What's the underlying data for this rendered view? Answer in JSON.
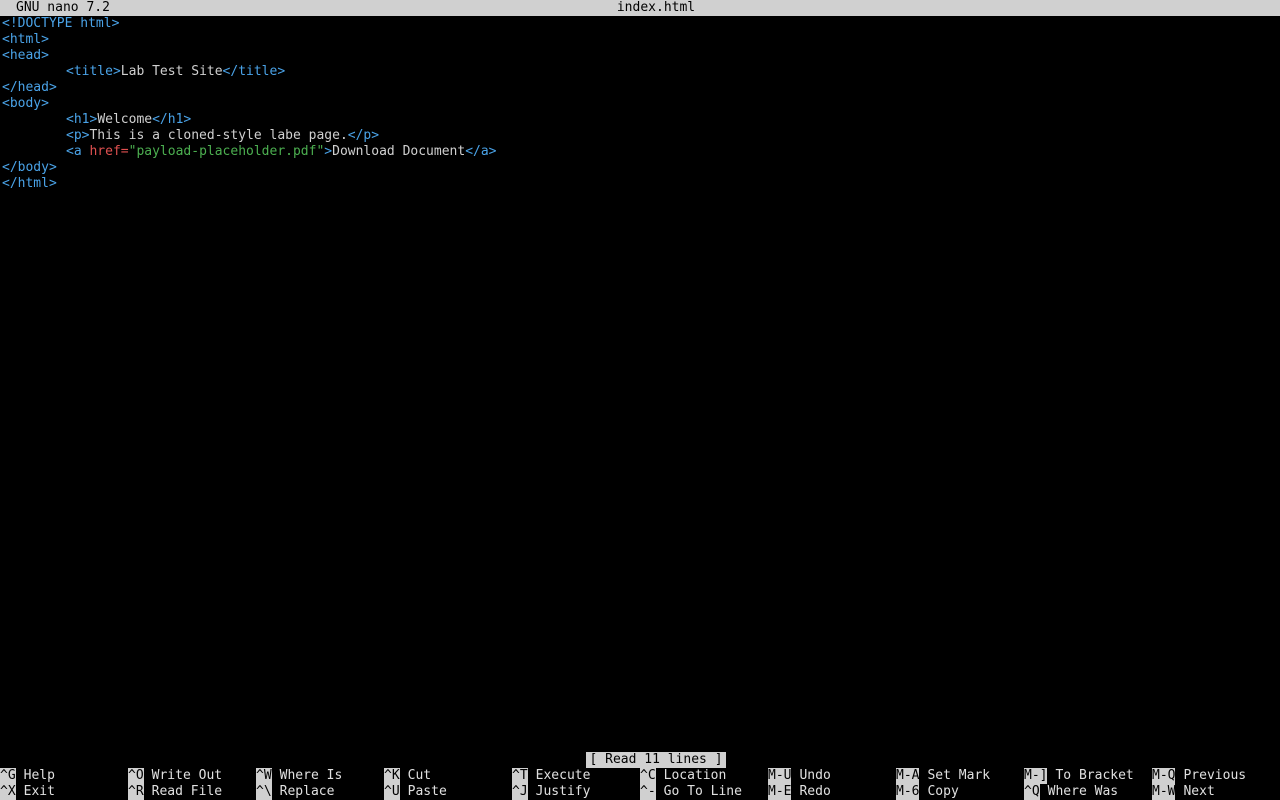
{
  "titlebar": {
    "version": "GNU nano 7.2",
    "filename": "index.html"
  },
  "code": [
    {
      "indent": 0,
      "parts": [
        {
          "cls": "tag",
          "text": "<!DOCTYPE html>"
        }
      ]
    },
    {
      "indent": 0,
      "parts": [
        {
          "cls": "tag",
          "text": "<html>"
        }
      ]
    },
    {
      "indent": 0,
      "parts": [
        {
          "cls": "tag",
          "text": "<head>"
        }
      ]
    },
    {
      "indent": 1,
      "parts": [
        {
          "cls": "tag",
          "text": "<title>"
        },
        {
          "cls": "txt",
          "text": "Lab Test Site"
        },
        {
          "cls": "tag",
          "text": "</title>"
        }
      ]
    },
    {
      "indent": 0,
      "parts": [
        {
          "cls": "tag",
          "text": "</head>"
        }
      ]
    },
    {
      "indent": 0,
      "parts": [
        {
          "cls": "tag",
          "text": "<body>"
        }
      ]
    },
    {
      "indent": 1,
      "parts": [
        {
          "cls": "tag",
          "text": "<h1>"
        },
        {
          "cls": "txt",
          "text": "Welcome"
        },
        {
          "cls": "tag",
          "text": "</h1>"
        }
      ]
    },
    {
      "indent": 1,
      "parts": [
        {
          "cls": "tag",
          "text": "<p>"
        },
        {
          "cls": "txt",
          "text": "This is a cloned-style labe page."
        },
        {
          "cls": "tag",
          "text": "</p>"
        }
      ]
    },
    {
      "indent": 1,
      "parts": [
        {
          "cls": "tag",
          "text": "<a "
        },
        {
          "cls": "attr",
          "text": "href="
        },
        {
          "cls": "val",
          "text": "\"payload-placeholder.pdf\""
        },
        {
          "cls": "tag",
          "text": ">"
        },
        {
          "cls": "txt",
          "text": "Download Document"
        },
        {
          "cls": "tag",
          "text": "</a>"
        }
      ]
    },
    {
      "indent": 0,
      "parts": [
        {
          "cls": "tag",
          "text": "</body>"
        }
      ]
    },
    {
      "indent": 0,
      "parts": [
        {
          "cls": "tag",
          "text": "</html>"
        }
      ]
    }
  ],
  "status": "[ Read 11 lines ]",
  "shortcuts": {
    "row1": [
      {
        "key": "^G",
        "label": "Help"
      },
      {
        "key": "^O",
        "label": "Write Out"
      },
      {
        "key": "^W",
        "label": "Where Is"
      },
      {
        "key": "^K",
        "label": "Cut"
      },
      {
        "key": "^T",
        "label": "Execute"
      },
      {
        "key": "^C",
        "label": "Location"
      },
      {
        "key": "M-U",
        "label": "Undo"
      },
      {
        "key": "M-A",
        "label": "Set Mark"
      },
      {
        "key": "M-]",
        "label": "To Bracket"
      },
      {
        "key": "M-Q",
        "label": "Previous"
      }
    ],
    "row2": [
      {
        "key": "^X",
        "label": "Exit"
      },
      {
        "key": "^R",
        "label": "Read File"
      },
      {
        "key": "^\\",
        "label": "Replace"
      },
      {
        "key": "^U",
        "label": "Paste"
      },
      {
        "key": "^J",
        "label": "Justify"
      },
      {
        "key": "^-",
        "label": "Go To Line"
      },
      {
        "key": "M-E",
        "label": "Redo"
      },
      {
        "key": "M-6",
        "label": "Copy"
      },
      {
        "key": "^Q",
        "label": "Where Was"
      },
      {
        "key": "M-W",
        "label": "Next"
      }
    ]
  },
  "colors": {
    "background": "#000000",
    "bar": "#d0d0d0",
    "tag": "#4aa3e8",
    "attribute": "#e05050",
    "string": "#4caf50",
    "text": "#d0d0d0"
  }
}
